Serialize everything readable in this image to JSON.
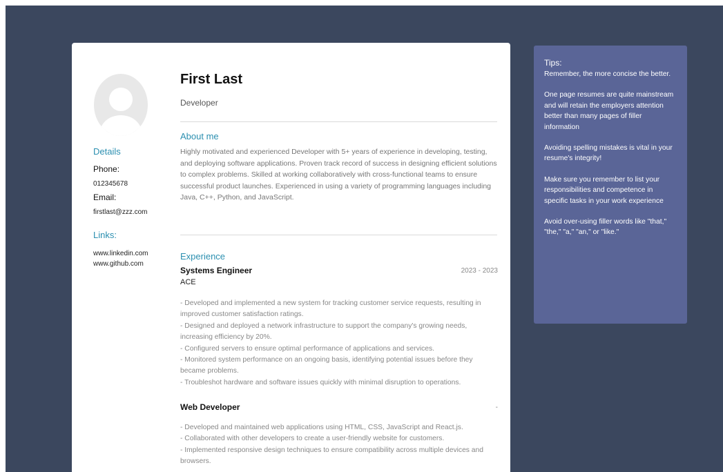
{
  "resume": {
    "name": "First Last",
    "title": "Developer",
    "details_heading": "Details",
    "phone_label": "Phone:",
    "phone": "012345678",
    "email_label": "Email:",
    "email": "firstlast@zzz.com",
    "links_heading": "Links:",
    "links": [
      "www.linkedin.com",
      "www.github.com"
    ],
    "about_heading": "About me",
    "about": "Highly motivated and experienced Developer with 5+ years of experience in developing, testing, and deploying software applications. Proven track record of success in designing efficient solutions to complex problems. Skilled at working collaboratively with cross-functional teams to ensure successful product launches. Experienced in using a variety of programming languages including Java, C++, Python, and JavaScript.",
    "experience_heading": "Experience",
    "jobs": [
      {
        "title": "Systems Engineer",
        "company": "ACE",
        "dates": "2023 - 2023",
        "bullets": "- Developed and implemented a new system for tracking customer service requests, resulting in improved customer satisfaction ratings.\n- Designed and deployed a network infrastructure to support the company's growing needs, increasing efficiency by 20%.\n- Configured servers to ensure optimal performance of applications and services.\n- Monitored system performance on an ongoing basis, identifying potential issues before they became problems.\n- Troubleshot hardware and software issues quickly with minimal disruption to operations."
      },
      {
        "title": "Web Developer",
        "dates": "-",
        "bullets": "- Developed and maintained web applications using HTML, CSS, JavaScript and React.js.\n- Collaborated with other developers to create a user-friendly website for customers.\n- Implemented responsive design techniques to ensure compatibility across multiple devices and browsers."
      }
    ]
  },
  "tips": {
    "heading": "Tips:",
    "items": [
      "Remember, the more concise the better.",
      "One page resumes are quite mainstream and will retain the employers attention better than many pages of filler information",
      "Avoiding spelling mistakes is vital in your resume's integrity!",
      "Make sure you remember to list your responsibilities and competence in specific tasks in your work experience",
      "Avoid over-using filler words like \"that,\" \"the,\" \"a,\" \"an,\" or \"like.\""
    ]
  },
  "colors": {
    "background": "#3b475e",
    "accent": "#2b8fb0",
    "tips_panel": "#5a6597"
  }
}
